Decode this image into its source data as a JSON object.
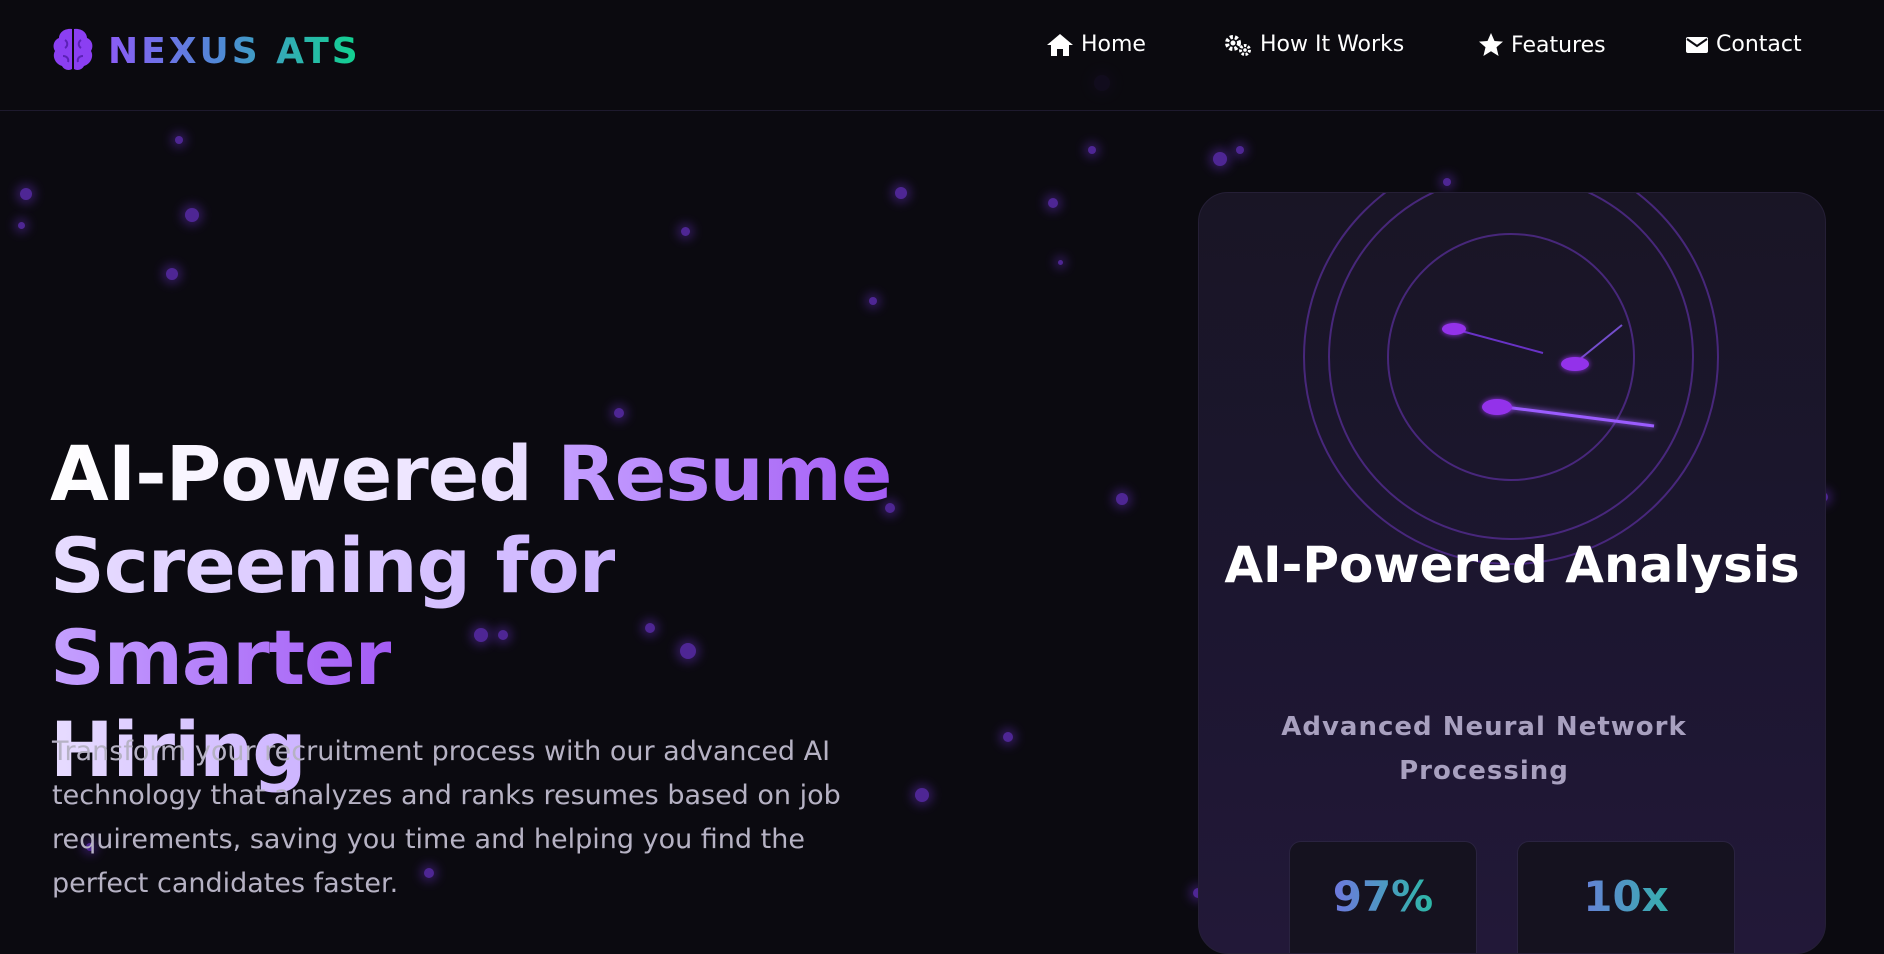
{
  "header": {
    "logo_text": "NEXUS ATS",
    "nav": [
      {
        "label": "Home",
        "icon": "home-icon"
      },
      {
        "label": "How It Works",
        "icon": "gears-icon"
      },
      {
        "label": "Features",
        "icon": "star-icon"
      },
      {
        "label": "Contact",
        "icon": "envelope-icon"
      }
    ]
  },
  "hero": {
    "title_parts": [
      "AI-Powered",
      "Resume",
      "Screening for",
      "Smarter",
      "Hiring"
    ],
    "description": "Transform your recruitment process with our advanced AI technology that analyzes and ranks resumes based on job requirements, saving you time and helping you find the perfect candidates faster."
  },
  "card": {
    "title": "AI-Powered Analysis",
    "subtitle": "Advanced Neural Network Processing",
    "stats": [
      {
        "value": "97%"
      },
      {
        "value": "10x"
      }
    ]
  },
  "colors": {
    "accent": "#8b5cf6",
    "accent_green": "#10d48e",
    "background": "#0b0a10"
  }
}
